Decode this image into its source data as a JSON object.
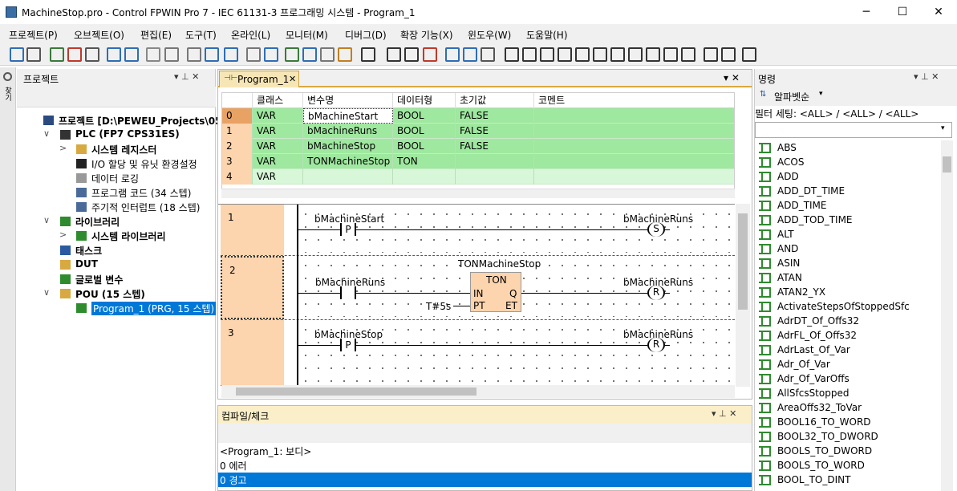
{
  "window": {
    "title": "MachineStop.pro - Control FPWIN Pro 7 - IEC 61131-3 프로그래밍 시스템 - Program_1",
    "minimize": "─",
    "maximize": "☐",
    "close": "✕"
  },
  "menu": [
    "프로젝트(P)",
    "오브젝트(O)",
    "편집(E)",
    "도구(T)",
    "온라인(L)",
    "모니터(M)",
    "디버그(D)",
    "확장 기능(X)",
    "윈도우(W)",
    "도움말(H)"
  ],
  "left_strip": {
    "label": "찾기"
  },
  "project_panel": {
    "title": "프로젝트",
    "tools": "▾ ⊥ ✕",
    "tree": [
      {
        "label": "프로젝트 [D:\\PEWEU_Projects\\05FPWIN",
        "bold": true
      },
      {
        "label": "PLC (FP7 CPS31ES)",
        "bold": true
      },
      {
        "label": "시스템 레지스터",
        "bold": true
      },
      {
        "label": "I/O 할당 및 유닛 환경설정",
        "bold": false
      },
      {
        "label": "데이터 로깅",
        "bold": false
      },
      {
        "label": "프로그램 코드 (34 스텝)",
        "bold": false
      },
      {
        "label": "주기적 인터럽트 (18 스텝)",
        "bold": false
      },
      {
        "label": "라이브러리",
        "bold": true
      },
      {
        "label": "시스템 라이브러리",
        "bold": true
      },
      {
        "label": "태스크",
        "bold": true
      },
      {
        "label": "DUT",
        "bold": true
      },
      {
        "label": "글로벌 변수",
        "bold": true
      },
      {
        "label": "POU (15 스텝)",
        "bold": true
      },
      {
        "label": "Program_1 (PRG, 15 스텝)",
        "bold": false
      }
    ]
  },
  "editor": {
    "tab": "Program_1",
    "tab_close": "✕",
    "pane_tools": "▾ ✕",
    "var_table": {
      "columns": [
        "",
        "클래스",
        "변수명",
        "데이터형",
        "초기값",
        "코멘트"
      ],
      "rows": [
        [
          "0",
          "VAR",
          "bMachineStart",
          "BOOL",
          "FALSE",
          ""
        ],
        [
          "1",
          "VAR",
          "bMachineRuns",
          "BOOL",
          "FALSE",
          ""
        ],
        [
          "2",
          "VAR",
          "bMachineStop",
          "BOOL",
          "FALSE",
          ""
        ],
        [
          "3",
          "VAR",
          "TONMachineStop",
          "TON",
          "",
          ""
        ],
        [
          "4",
          "VAR",
          "",
          "",
          "",
          ""
        ]
      ]
    },
    "ladder": [
      {
        "num": "1",
        "contact_var": "bMachineStart",
        "contact_type": "P",
        "coil_var": "bMachineRuns",
        "coil_type": "S"
      },
      {
        "num": "2",
        "contact_var": "bMachineRuns",
        "contact_type": "",
        "coil_var": "bMachineRuns",
        "coil_type": "R",
        "fb": {
          "instance": "TONMachineStop",
          "type": "TON",
          "in": "IN",
          "pt": "PT",
          "q": "Q",
          "et": "ET",
          "pt_value": "T#5s"
        }
      },
      {
        "num": "3",
        "contact_var": "bMachineStop",
        "contact_type": "P",
        "coil_var": "bMachineRuns",
        "coil_type": "R"
      }
    ]
  },
  "compile_panel": {
    "title": "컴파일/체크",
    "tools": "▾ ⊥ ✕",
    "lines": [
      "<Program_1: 보디>",
      "0 에러",
      "0 경고"
    ]
  },
  "command_panel": {
    "title": "명령",
    "tools": "▾ ⊥ ✕",
    "sort_label": "알파벳순",
    "filter_label": "필터 세팅: <ALL> / <ALL> / <ALL>",
    "items": [
      "ABS",
      "ACOS",
      "ADD",
      "ADD_DT_TIME",
      "ADD_TIME",
      "ADD_TOD_TIME",
      "ALT",
      "AND",
      "ASIN",
      "ATAN",
      "ATAN2_YX",
      "ActivateStepsOfStoppedSfc",
      "AdrDT_Of_Offs32",
      "AdrFL_Of_Offs32",
      "AdrLast_Of_Var",
      "Adr_Of_Var",
      "Adr_Of_VarOffs",
      "AllSfcsStopped",
      "AreaOffs32_ToVar",
      "BOOL16_TO_WORD",
      "BOOL32_TO_DWORD",
      "BOOLS_TO_DWORD",
      "BOOLS_TO_WORD",
      "BOOL_TO_DINT"
    ]
  }
}
